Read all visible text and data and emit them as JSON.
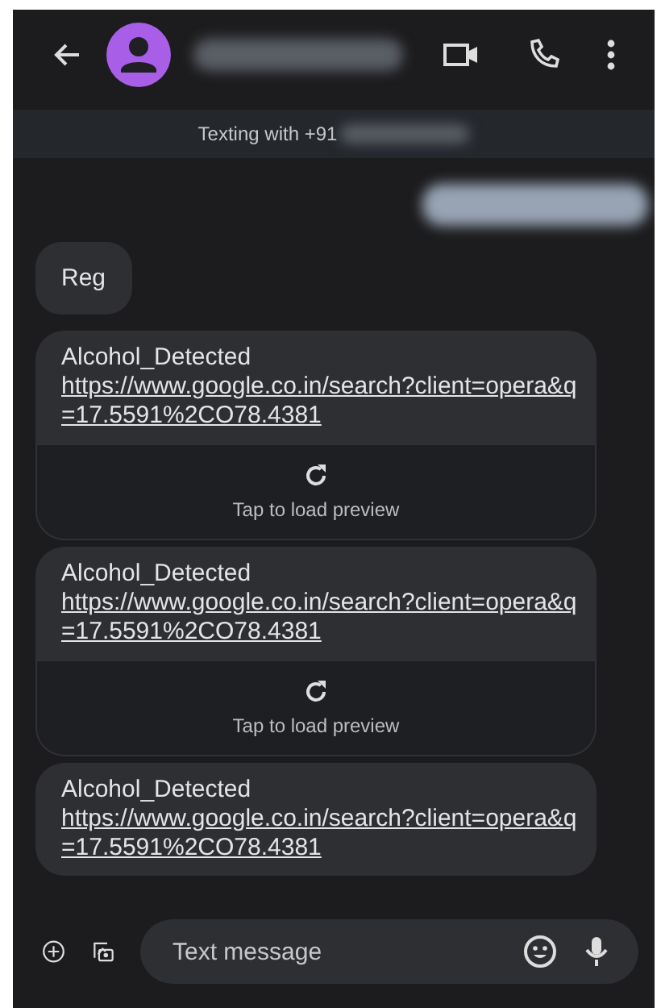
{
  "banner": {
    "text": "Texting with +91"
  },
  "messages": [
    {
      "kind": "sent-redacted"
    },
    {
      "kind": "received",
      "text": "Reg"
    },
    {
      "kind": "link",
      "prefix": "Alcohol_Detected",
      "link": "https://www.google.co.in/search?client=opera&q=17.5591%2CO78.4381",
      "preview": "Tap to load preview"
    },
    {
      "kind": "link",
      "prefix": "Alcohol_Detected",
      "link": "https://www.google.co.in/search?client=opera&q=17.5591%2CO78.4381",
      "preview": "Tap to load preview"
    },
    {
      "kind": "link",
      "prefix": "Alcohol_Detected",
      "link": "https://www.google.co.in/search?client=opera&q=17.5591%2CO78.4381"
    }
  ],
  "composer": {
    "placeholder": "Text message"
  }
}
